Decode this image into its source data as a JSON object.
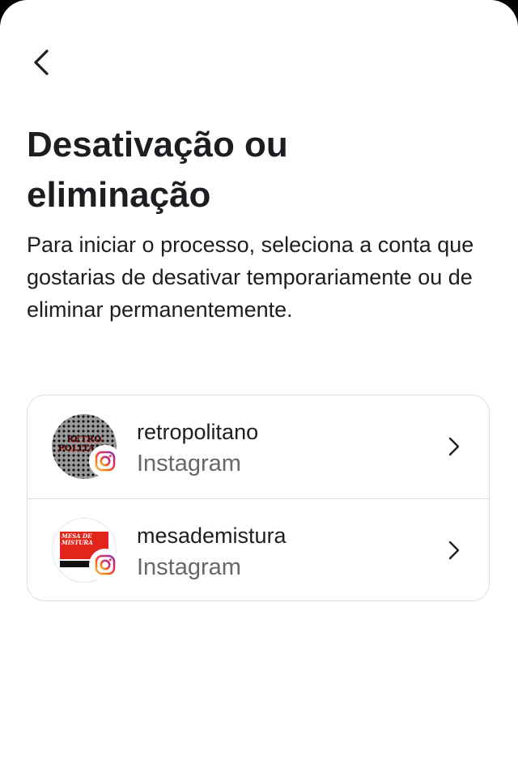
{
  "header": {
    "back_icon": "chevron-left-icon",
    "title": "Desativação ou eliminação",
    "description": "Para iniciar o processo, seleciona a conta que gostarias de desativar temporariamente ou de eliminar permanentemente."
  },
  "accounts": [
    {
      "username": "retropolitano",
      "platform": "Instagram",
      "avatar_text": "RETRO POLITANO",
      "badge_icon": "instagram-icon",
      "chevron_icon": "chevron-right-icon"
    },
    {
      "username": "mesademistura",
      "platform": "Instagram",
      "avatar_text": "MESA DE MISTURA",
      "badge_icon": "instagram-icon",
      "chevron_icon": "chevron-right-icon"
    }
  ],
  "colors": {
    "text_primary": "#1c1e21",
    "text_secondary": "#65676b",
    "border": "#dadde1",
    "background": "#ffffff"
  }
}
